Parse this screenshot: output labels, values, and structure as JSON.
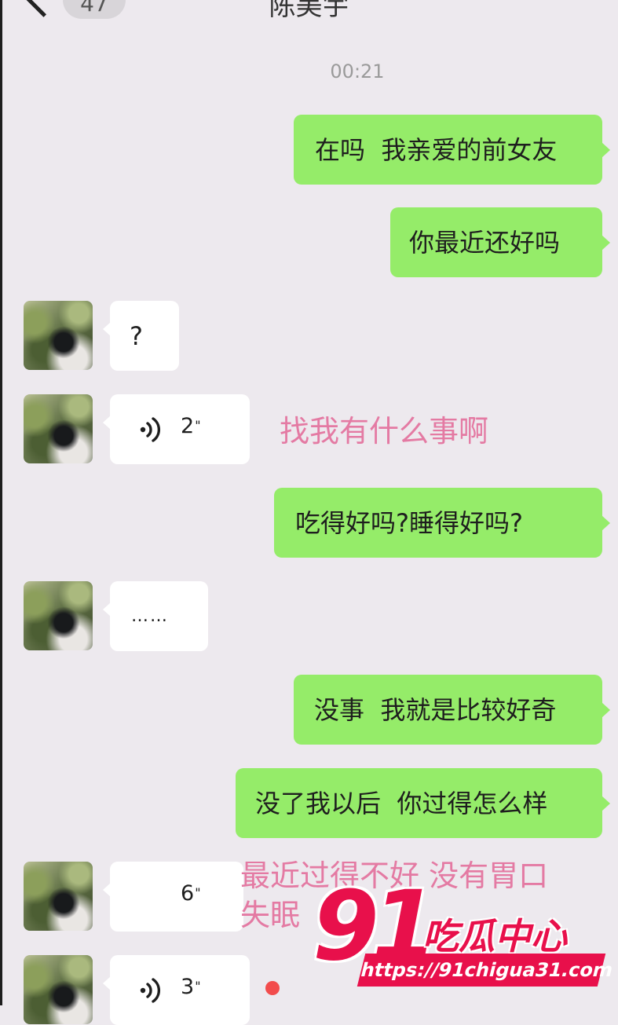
{
  "header": {
    "back_icon": "chevron-left-icon",
    "unread_count": "47",
    "title": "陈美宇"
  },
  "timestamp": "00:21",
  "messages": [
    {
      "from": "me",
      "type": "text",
      "text": "在吗  我亲爱的前女友"
    },
    {
      "from": "me",
      "type": "text",
      "text": "你最近还好吗"
    },
    {
      "from": "them",
      "type": "text",
      "text": "?"
    },
    {
      "from": "them",
      "type": "voice",
      "duration": "2",
      "duration_mark": "\"",
      "icon": "voice-wave-icon"
    },
    {
      "from": "me",
      "type": "text",
      "text": "吃得好吗?睡得好吗?"
    },
    {
      "from": "them",
      "type": "text",
      "text": "……"
    },
    {
      "from": "me",
      "type": "text",
      "text": "没事  我就是比较好奇"
    },
    {
      "from": "me",
      "type": "text",
      "text": "没了我以后  你过得怎么样"
    },
    {
      "from": "them",
      "type": "voice",
      "duration": "6",
      "duration_mark": "\""
    },
    {
      "from": "them",
      "type": "voice",
      "duration": "3",
      "duration_mark": "\"",
      "icon": "voice-wave-icon",
      "unread": true
    }
  ],
  "captions": {
    "voice_1": "找我有什么事啊",
    "voice_2_line1": "最近过得不好 没有胃口",
    "voice_2_line2": "失眠"
  },
  "watermark": {
    "number": "91",
    "name": "吃瓜中心",
    "url": "https://91chigua31.com"
  },
  "colors": {
    "background": "#ede9ee",
    "my_bubble": "#95ec69",
    "their_bubble": "#ffffff",
    "caption": "#e47aa3",
    "watermark": "#e8104b",
    "unread_dot": "#f24c4c"
  }
}
